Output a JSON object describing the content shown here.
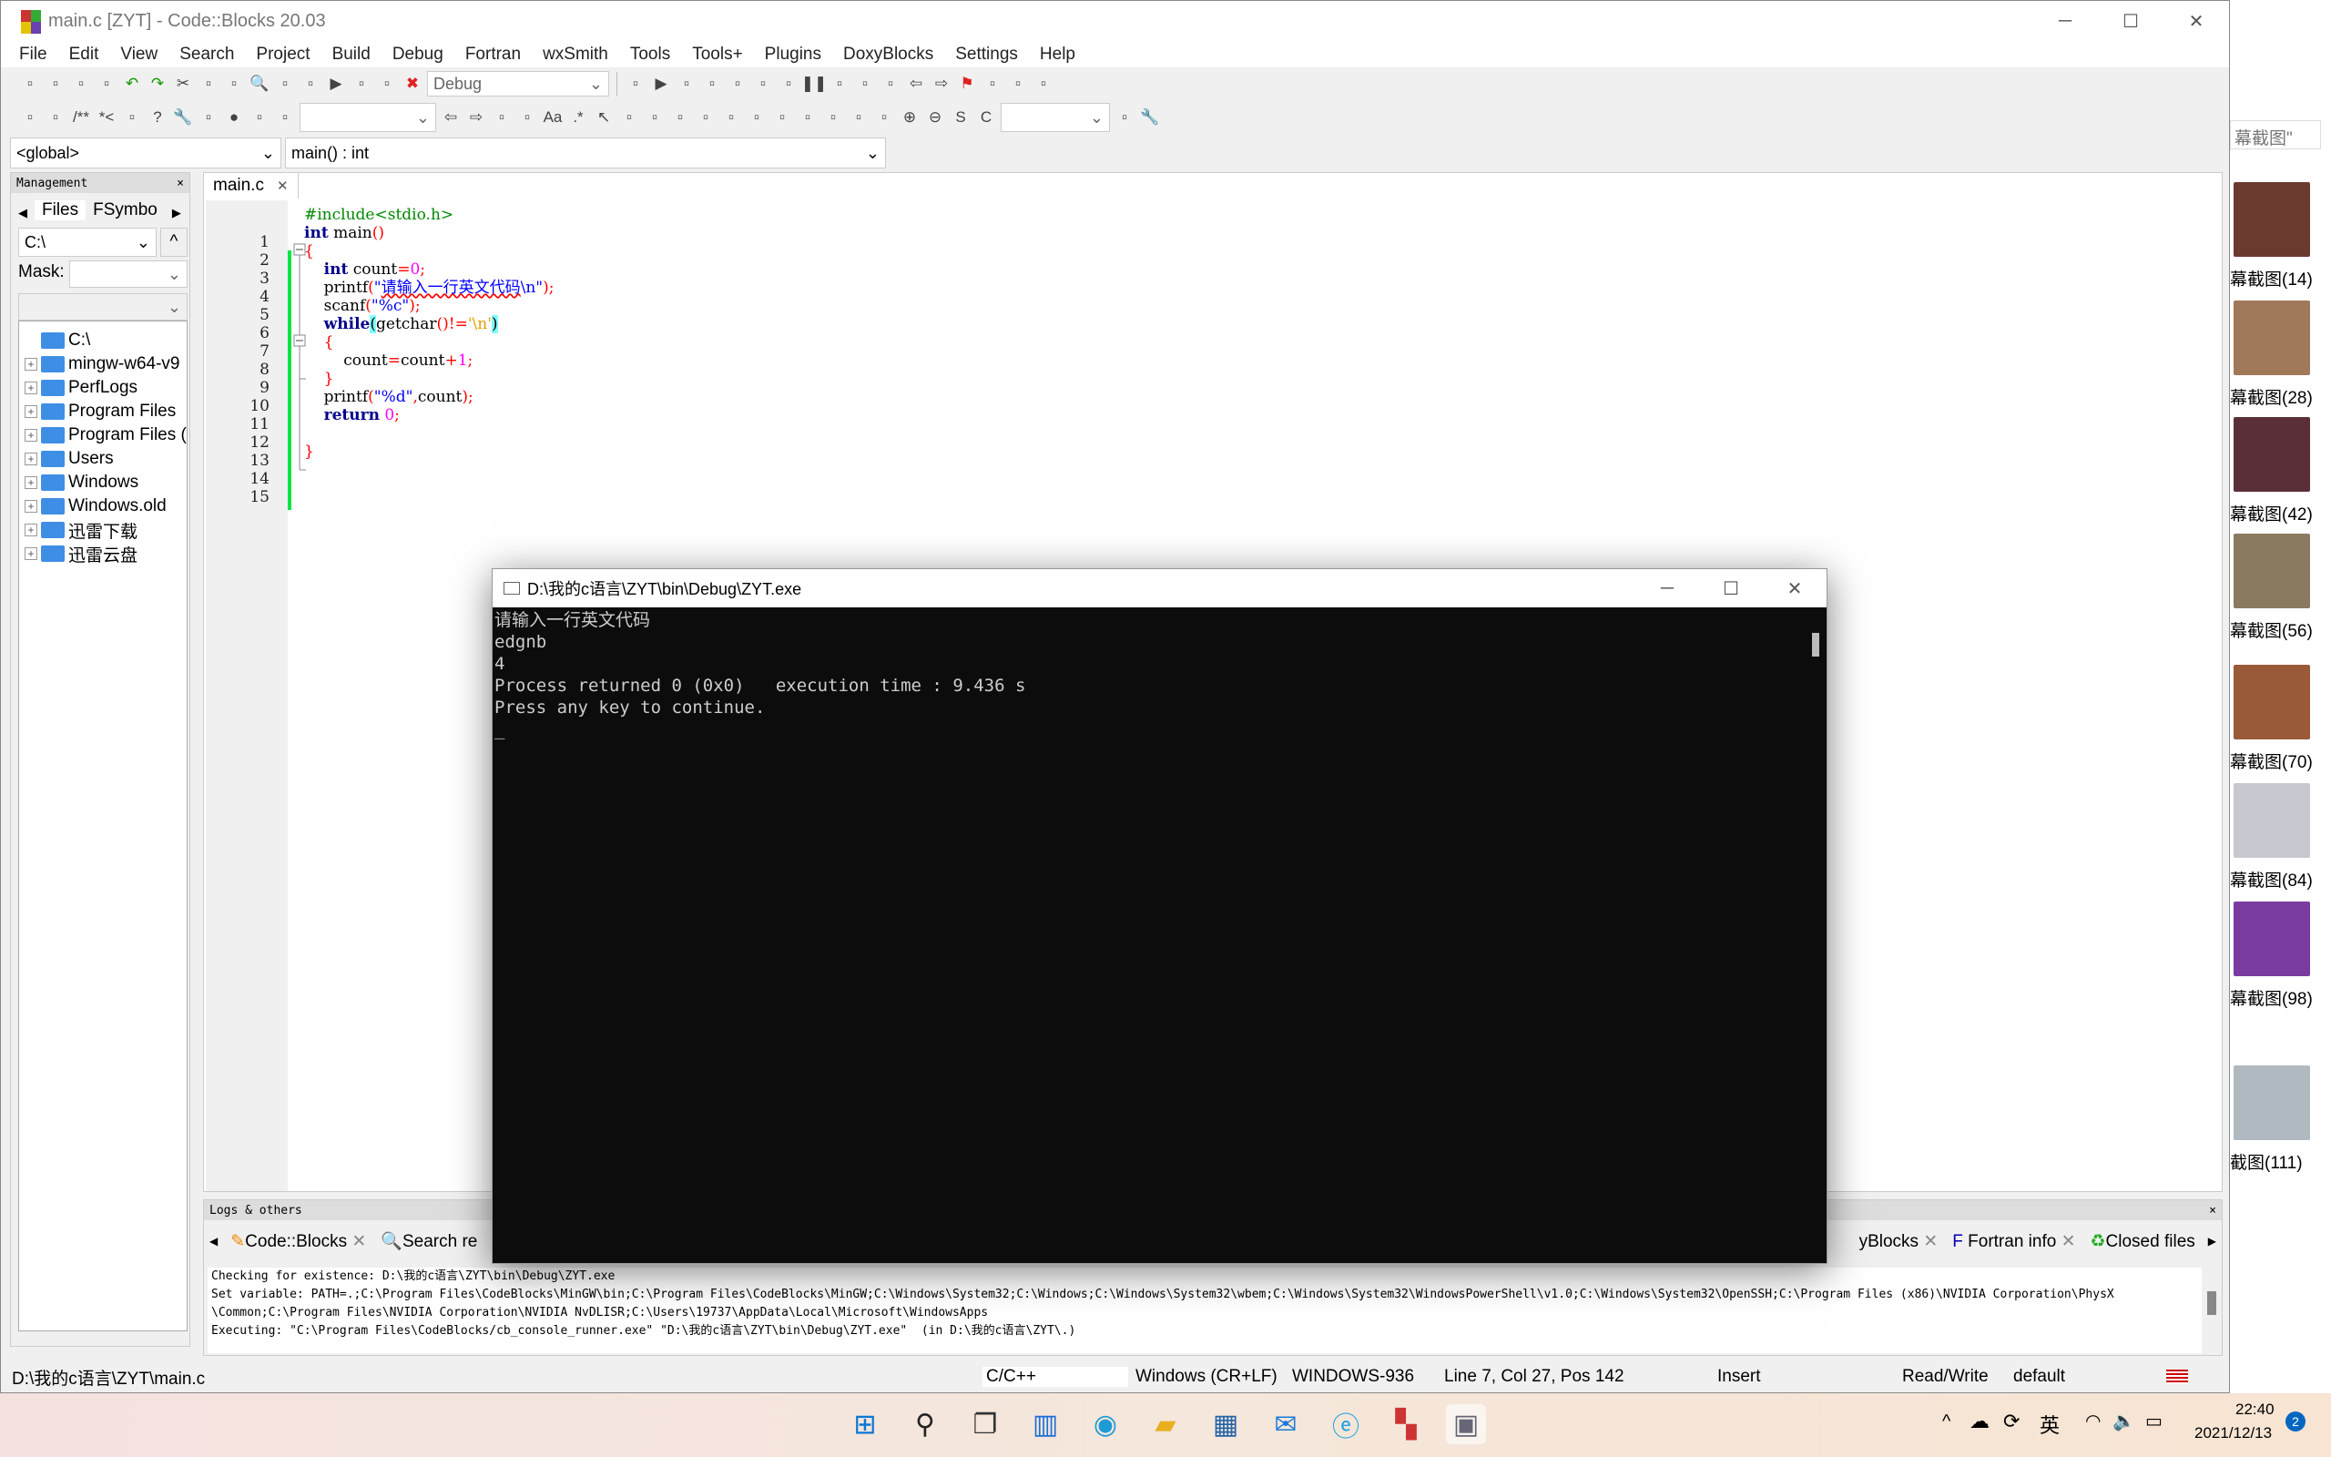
{
  "window": {
    "title": "main.c [ZYT] - Code::Blocks 20.03",
    "minimize": "─",
    "maximize": "☐",
    "close": "✕"
  },
  "menu": [
    "File",
    "Edit",
    "View",
    "Search",
    "Project",
    "Build",
    "Debug",
    "Fortran",
    "wxSmith",
    "Tools",
    "Tools+",
    "Plugins",
    "DoxyBlocks",
    "Settings",
    "Help"
  ],
  "toolbar1": {
    "icons_a": [
      "new-file-icon",
      "open-icon",
      "save-icon",
      "save-all-icon",
      "undo-icon",
      "redo-icon",
      "cut-icon",
      "copy-icon",
      "paste-icon",
      "find-icon",
      "replace-icon",
      "build-settings-icon",
      "run-icon",
      "build-run-icon",
      "rebuild-icon",
      "abort-icon"
    ],
    "build_target": "Debug",
    "icons_b": [
      "target-settings-icon",
      "debug-run-icon",
      "run-to-cursor-icon",
      "next-line-icon",
      "step-into-icon",
      "step-out-icon",
      "next-instruction-icon",
      "break-icon",
      "stop-debugger-icon",
      "debug-windows-icon",
      "info-icon",
      "prev-bookmark-icon",
      "next-bookmark-icon",
      "toggle-bookmark-icon",
      "prev-mark-icon",
      "next-mark-icon",
      "clear-marks-icon"
    ]
  },
  "toolbar2": {
    "icons_a": [
      "doxywizard-icon",
      "extract-docs-icon",
      "block-comment-icon",
      "line-comment-icon",
      "run-html-icon",
      "help-icon",
      "config-icon",
      "jump-back-icon",
      "breakpoint-icon",
      "jump-forward-icon",
      "clear-icon"
    ],
    "search_value": "",
    "icons_b": [
      "back-icon",
      "forward-icon",
      "highlight-icon",
      "selected-text-icon",
      "match-case-icon",
      "regex-icon",
      "select-icon",
      "wx-panel-icon",
      "wx-box-icon",
      "wx-grid-icon",
      "wx-flex-icon",
      "wx-static-icon",
      "wx-sizer-icon",
      "wx-wrap-icon",
      "wx-spacer-icon",
      "wx-frame-icon",
      "wx-dialog-icon",
      "wx-scroll-icon",
      "zoom-in-icon",
      "zoom-out-icon",
      "s-icon",
      "c-icon"
    ],
    "combo2_value": "",
    "icons_c": [
      "find-symbol-icon",
      "settings-wrench-icon"
    ]
  },
  "scope": {
    "global": "<global>",
    "function": "main() : int"
  },
  "management": {
    "header": "Management",
    "close": "×",
    "tabs": [
      "Files",
      "FSymbo"
    ],
    "path": "C:\\",
    "mask_label": "Mask:",
    "mask_value": "",
    "tree": [
      {
        "label": "C:\\",
        "expandable": false
      },
      {
        "label": "mingw-w64-v9",
        "expandable": true
      },
      {
        "label": "PerfLogs",
        "expandable": true
      },
      {
        "label": "Program Files",
        "expandable": true
      },
      {
        "label": "Program Files (",
        "expandable": true
      },
      {
        "label": "Users",
        "expandable": true
      },
      {
        "label": "Windows",
        "expandable": true
      },
      {
        "label": "Windows.old",
        "expandable": true
      },
      {
        "label": "迅雷下载",
        "expandable": true
      },
      {
        "label": "迅雷云盘",
        "expandable": true
      }
    ]
  },
  "editor": {
    "tab": "main.c",
    "tab_close": "✕",
    "line_numbers": [
      "1",
      "2",
      "3",
      "4",
      "5",
      "6",
      "7",
      "8",
      "9",
      "10",
      "11",
      "12",
      "13",
      "14",
      "15"
    ]
  },
  "console": {
    "title": "D:\\我的c语言\\ZYT\\bin\\Debug\\ZYT.exe",
    "lines": [
      "请输入一行英文代码",
      "edgnb",
      "4",
      "Process returned 0 (0x0)   execution time : 9.436 s",
      "Press any key to continue.",
      "_"
    ]
  },
  "logs": {
    "header": "Logs & others",
    "close": "×",
    "tabs": [
      "Code::Blocks",
      "Search re",
      "yBlocks",
      "Fortran info",
      "Closed files"
    ],
    "lines": [
      "Checking for existence: D:\\我的c语言\\ZYT\\bin\\Debug\\ZYT.exe",
      "Set variable: PATH=.;C:\\Program Files\\CodeBlocks\\MinGW\\bin;C:\\Program Files\\CodeBlocks\\MinGW;C:\\Windows\\System32;C:\\Windows;C:\\Windows\\System32\\wbem;C:\\Windows\\System32\\WindowsPowerShell\\v1.0;C:\\Windows\\System32\\OpenSSH;C:\\Program Files (x86)\\NVIDIA Corporation\\PhysX",
      "\\Common;C:\\Program Files\\NVIDIA Corporation\\NVIDIA NvDLISR;C:\\Users\\19737\\AppData\\Local\\Microsoft\\WindowsApps",
      "Executing: \"C:\\Program Files\\CodeBlocks/cb_console_runner.exe\" \"D:\\我的c语言\\ZYT\\bin\\Debug\\ZYT.exe\"  (in D:\\我的c语言\\ZYT\\.)"
    ]
  },
  "status": {
    "path": "D:\\我的c语言\\ZYT\\main.c",
    "language": "C/C++",
    "eol": "Windows (CR+LF)",
    "encoding": "WINDOWS-936",
    "position": "Line 7, Col 27, Pos 142",
    "mode": "Insert",
    "access": "Read/Write",
    "profile": "default"
  },
  "taskbar": {
    "time": "22:40",
    "date": "2021/12/13",
    "notifications": "2",
    "ime": "英",
    "icons": [
      "start-icon",
      "search-icon",
      "task-view-icon",
      "widgets-icon",
      "edge-icon",
      "file-explorer-icon",
      "store-icon",
      "mail-icon",
      "browser-icon",
      "codeblocks-icon",
      "console-icon"
    ]
  },
  "right_panel": {
    "search": "幕截图\"",
    "thumbs": [
      "幕截图(14)",
      "幕截图(28)",
      "幕截图(42)",
      "幕截图(56)",
      "幕截图(70)",
      "幕截图(84)",
      "幕截图(98)",
      "截图(111)"
    ]
  }
}
